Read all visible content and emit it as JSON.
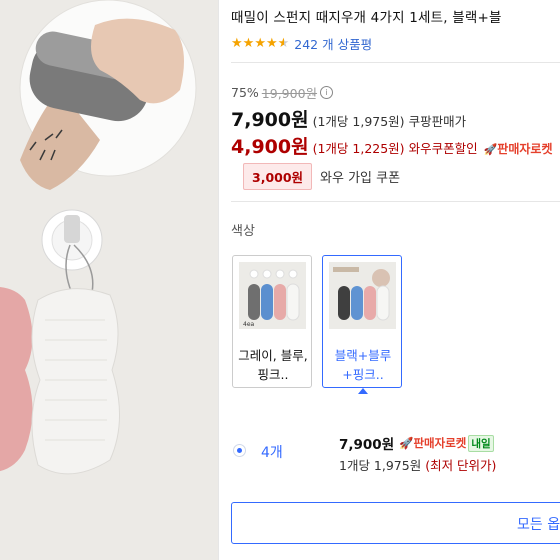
{
  "product": {
    "title": "때밀이 스펀지 때지우개 4가지 1세트, 블랙+블",
    "rating": 4.5,
    "review_count": "242 개 상품평"
  },
  "pricing": {
    "discount_rate": "75%",
    "original_price": "19,900원",
    "info_icon": "ⓘ",
    "price": "7,900원",
    "unit_price": "(1개당 1,975원)",
    "price_label": "쿠팡판매가",
    "coupon_price": "4,900원",
    "coupon_unit_price": "(1개당 1,225원)",
    "coupon_label": "와우쿠폰할인",
    "rocket_label": "판매자로켓",
    "member_coupon_amount": "3,000원",
    "member_coupon_text": "와우 가입 쿠폰"
  },
  "options": {
    "label": "색상",
    "items": [
      {
        "name": "그레이, 블루, 핑크..",
        "selected": false
      },
      {
        "name": "블랙+블루+핑크..",
        "selected": true
      }
    ],
    "thumb_tag": "4ea"
  },
  "quantity": {
    "label": "4개",
    "price": "7,900원",
    "rocket_label": "판매자로켓",
    "tomorrow_badge": "내일",
    "unit_price": "1개당 1,975원",
    "lowest_unit": "(최저 단위가)"
  },
  "all_options_button": "모든 옵",
  "colors": {
    "accent": "#346aff",
    "coupon_red": "#ae0000",
    "rocket_red": "#e5402c",
    "star": "#f5a300"
  }
}
